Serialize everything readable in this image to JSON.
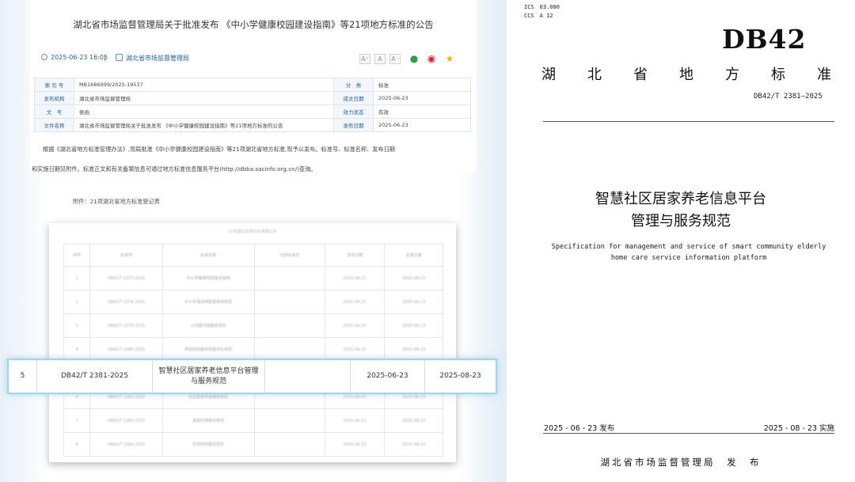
{
  "notice": {
    "title": "湖北省市场监督管理局关于批准发布 《中小学健康校园建设指南》等21项地方标准的公告",
    "date": "2025-06-23 16:05",
    "separator": "|",
    "source": "湖北省市场监督管理局",
    "font_buttons": [
      "A⁺",
      "A",
      "A⁻"
    ],
    "meta": [
      {
        "k1": "索 引 号",
        "v1": "MB1686999/2025-19537",
        "k2": "分　类",
        "v2": "标准"
      },
      {
        "k1": "发布机构",
        "v1": "湖北省市场监督管理局",
        "k2": "成文日期",
        "v2": "2025-06-23"
      },
      {
        "k1": "文　号",
        "v1": "侯函",
        "k2": "效力状态",
        "v2": "有效"
      },
      {
        "k1": "文件名称",
        "v1": "湖北省市场监督管理局关于批准发布 《中小学健康校园建设指南》等21项地方标准的公告",
        "k2": "发布日期",
        "v2": "2025-06-23"
      }
    ],
    "body_line1": "根据《湖北省地方标准管理办法》,现局批准《中小学健康校园建设指南》等21项湖北省地方标准,现予以发布。标准号、标准名称、发布日期",
    "body_line2": "和实施日期见附件。标准正文和有关备案信息可通过地方标准信息服务平台(http://dbba.sacinfo.org.cn/)查询。",
    "attachment": "附件：21项湖北省地方标准登记表"
  },
  "register": {
    "title": "21项湖北省地方标准登记表",
    "headers": [
      "序号",
      "标准号",
      "标准名称",
      "代替标准号",
      "发布日期",
      "实施日期"
    ],
    "rows": [
      [
        "1",
        "DB42/T 2377-2025",
        "中小学健康校园建设指南",
        "",
        "2025-06-23",
        "2025-08-23"
      ],
      [
        "2",
        "DB42/T 2378-2025",
        "中小学课桌椅配置使用规范",
        "",
        "2025-06-23",
        "2025-08-23"
      ],
      [
        "3",
        "DB42/T 2379-2025",
        "公共图书馆服务规范",
        "",
        "2025-06-23",
        "2025-08-23"
      ],
      [
        "4",
        "DB42/T 2380-2025",
        "养老机构服务质量评价规范",
        "",
        "2025-06-23",
        "2025-08-23"
      ],
      [
        "6",
        "DB42/T 2382-2025",
        "社区居家养老服务规范",
        "",
        "2025-06-23",
        "2025-08-23"
      ],
      [
        "7",
        "DB42/T 2383-2025",
        "家庭托育服务规范",
        "",
        "2025-06-23",
        "2025-08-23"
      ],
      [
        "8",
        "DB42/T 2384-2025",
        "托育机构服务规范",
        "",
        "2025-06-23",
        "2025-08-23"
      ]
    ],
    "highlight": {
      "no": "5",
      "std_no": "DB42/T 2381-2025",
      "name": "智慧社区居家养老信息平台管理与服务规范",
      "replaces": "",
      "issue_date": "2025-06-23",
      "impl_date": "2025-08-23"
    }
  },
  "cover": {
    "ics": "ICS　03.080",
    "ccs": "CCS　A 12",
    "code": "DB42",
    "level_title": [
      "湖",
      "北",
      "省",
      "地",
      "方",
      "标",
      "准"
    ],
    "std_no": "DB42/T 2381—2025",
    "title_line1": "智慧社区居家养老信息平台",
    "title_line2": "管理与服务规范",
    "en_line1": "Specification for management and service of smart community elderly",
    "en_line2": "home care service information platform",
    "issue": "2025 - 06 - 23 发布",
    "implement": "2025 - 08 - 23 实施",
    "publisher": "湖北省市场监督管理局　发　布"
  },
  "colors": {
    "link_blue": "#1f5fa6",
    "highlight_border": "#9fd6ea",
    "wechat": "#2ba245",
    "weibo": "#e6162d",
    "star": "#f2b50f"
  },
  "icons": [
    "clock-icon",
    "site-icon",
    "wechat-icon",
    "weibo-icon",
    "star-icon"
  ]
}
